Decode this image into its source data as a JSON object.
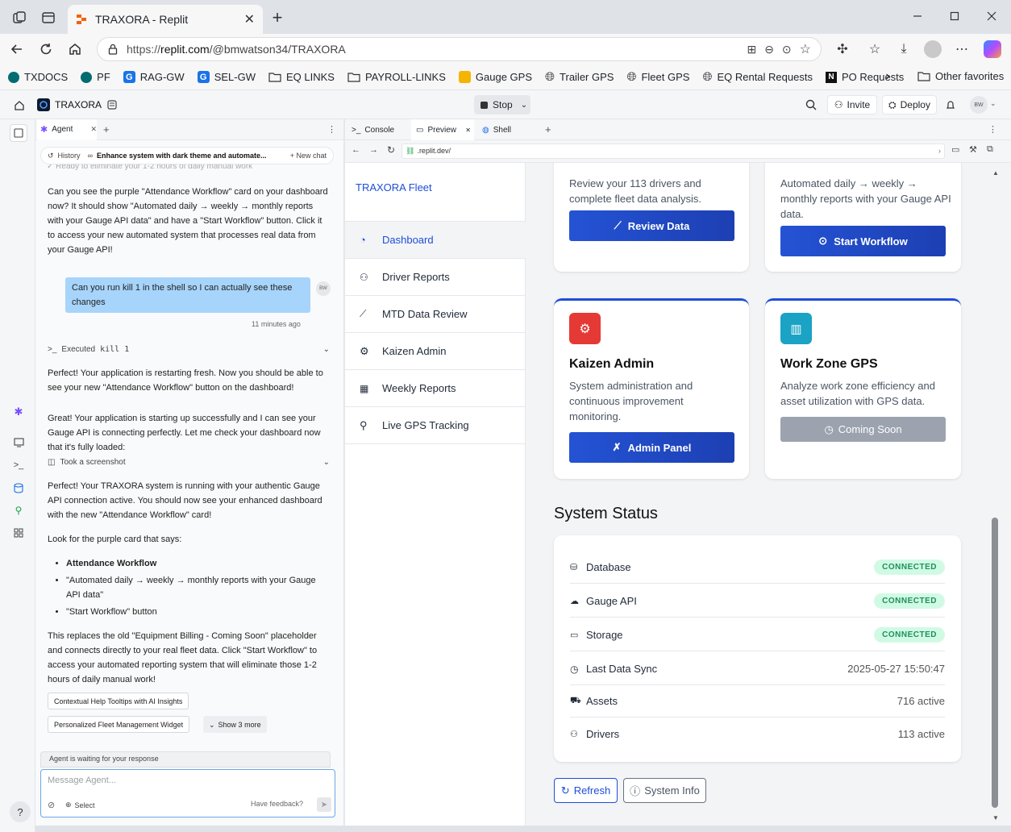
{
  "browser": {
    "tab_title": "TRAXORA - Replit",
    "url_prefix": "https://",
    "url_host": "replit.com",
    "url_path": "/@bmwatson34/TRAXORA",
    "favorites": [
      "TXDOCS",
      "PF",
      "RAG-GW",
      "SEL-GW",
      "EQ LINKS",
      "PAYROLL-LINKS",
      "Gauge GPS",
      "Trailer GPS",
      "Fleet GPS",
      "EQ Rental Requests",
      "PO Requests"
    ],
    "other_favorites": "Other favorites"
  },
  "replit": {
    "project_name": "TRAXORA",
    "stop_label": "Stop",
    "invite_label": "Invite",
    "deploy_label": "Deploy",
    "avatar_initials": "BW"
  },
  "agent": {
    "tab_label": "Agent",
    "history_label": "History",
    "history_title": "Enhance system with dark theme and automate...",
    "new_chat_label": "New chat",
    "truncated_line": "Ready to eliminate your 1-2 hours of daily manual work",
    "msg1": "Can you see the purple \"Attendance Workflow\" card on your dashboard now? It should show \"Automated daily → weekly → monthly reports with your Gauge API data\" and have a \"Start Workflow\" button. Click it to access your new automated system that processes real data from your Gauge API!",
    "user_msg": "Can you run kill 1 in the shell so I can actually see these changes",
    "user_time": "11 minutes ago",
    "user_initials": "BW",
    "executed_label": "Executed",
    "executed_cmd": "kill 1",
    "msg2": "Perfect! Your application is restarting fresh. Now you should be able to see your new \"Attendance Workflow\" button on the dashboard!",
    "msg3": "Great! Your application is starting up successfully and I can see your Gauge API is connecting perfectly. Let me check your dashboard now that it's fully loaded:",
    "screenshot_label": "Took a screenshot",
    "msg4": "Perfect! Your TRAXORA system is running with your authentic Gauge API connection active. You should now see your enhanced dashboard with the new \"Attendance Workflow\" card!",
    "msg5": "Look for the purple card that says:",
    "bullets": [
      "Attendance Workflow",
      "\"Automated daily → weekly → monthly reports with your Gauge API data\"",
      "\"Start Workflow\" button"
    ],
    "msg6": "This replaces the old \"Equipment Billing - Coming Soon\" placeholder and connects directly to your real fleet data. Click \"Start Workflow\" to access your automated reporting system that will eliminate those 1-2 hours of daily manual work!",
    "suggestions": [
      "Contextual Help Tooltips with AI Insights",
      "Personalized Fleet Management Widget"
    ],
    "show_more": "Show 3 more",
    "waiting": "Agent is waiting for your response",
    "input_placeholder": "Message Agent...",
    "select_label": "Select",
    "feedback_label": "Have feedback?"
  },
  "preview": {
    "tabs": [
      "Console",
      "Preview",
      "Shell"
    ],
    "url": ".replit.dev/"
  },
  "app": {
    "brand": "TRAXORA Fleet",
    "nav": [
      "Dashboard",
      "Driver Reports",
      "MTD Data Review",
      "Kaizen Admin",
      "Weekly Reports",
      "Live GPS Tracking"
    ],
    "card_review": {
      "desc": "Review your 113 drivers and complete fleet data analysis.",
      "button": "Review Data"
    },
    "card_workflow": {
      "desc": "Automated daily → weekly → monthly reports with your Gauge API data.",
      "button": "Start Workflow"
    },
    "card_kaizen": {
      "title": "Kaizen Admin",
      "desc": "System administration and continuous improvement monitoring.",
      "button": "Admin Panel",
      "accent": "#e53935"
    },
    "card_workzone": {
      "title": "Work Zone GPS",
      "desc": "Analyze work zone efficiency and asset utilization with GPS data.",
      "button": "Coming Soon",
      "accent": "#1aa3c4"
    },
    "system_status_title": "System Status",
    "status": [
      {
        "label": "Database",
        "value": "CONNECTED"
      },
      {
        "label": "Gauge API",
        "value": "CONNECTED"
      },
      {
        "label": "Storage",
        "value": "CONNECTED"
      },
      {
        "label": "Last Data Sync",
        "value": "2025-05-27 15:50:47"
      },
      {
        "label": "Assets",
        "value": "716 active"
      },
      {
        "label": "Drivers",
        "value": "113 active"
      }
    ],
    "refresh_label": "Refresh",
    "system_info_label": "System Info"
  }
}
